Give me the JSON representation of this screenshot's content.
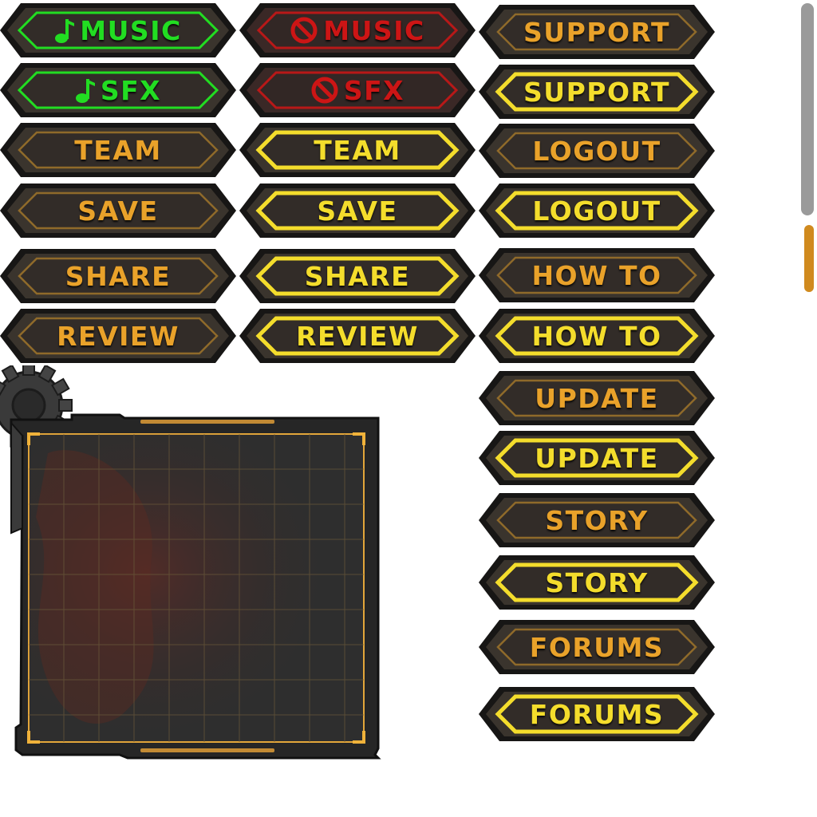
{
  "colors": {
    "gold": "#e9a22a",
    "yellow": "#f4dd2c",
    "green": "#22dd22",
    "red": "#cc1515",
    "dark_fill": "#2b2724",
    "scroll_track": "#9a9a9a",
    "scroll_thumb": "#d08a1e"
  },
  "buttons": [
    {
      "label": "MUSIC",
      "style": "on",
      "icon": "music-note-icon"
    },
    {
      "label": "SFX",
      "style": "on",
      "icon": "music-note-icon"
    },
    {
      "label": "TEAM",
      "style": "normal",
      "icon": ""
    },
    {
      "label": "SAVE",
      "style": "normal",
      "icon": ""
    },
    {
      "label": "SHARE",
      "style": "normal",
      "icon": ""
    },
    {
      "label": "REVIEW",
      "style": "normal",
      "icon": ""
    },
    {
      "label": "MUSIC",
      "style": "off",
      "icon": "prohibited-icon"
    },
    {
      "label": "SFX",
      "style": "off",
      "icon": "prohibited-icon"
    },
    {
      "label": "TEAM",
      "style": "highlight",
      "icon": ""
    },
    {
      "label": "SAVE",
      "style": "highlight",
      "icon": ""
    },
    {
      "label": "SHARE",
      "style": "highlight",
      "icon": ""
    },
    {
      "label": "REVIEW",
      "style": "highlight",
      "icon": ""
    },
    {
      "label": "SUPPORT",
      "style": "normal",
      "icon": ""
    },
    {
      "label": "SUPPORT",
      "style": "highlight",
      "icon": ""
    },
    {
      "label": "LOGOUT",
      "style": "normal",
      "icon": ""
    },
    {
      "label": "LOGOUT",
      "style": "highlight",
      "icon": ""
    },
    {
      "label": "HOW TO",
      "style": "normal",
      "icon": ""
    },
    {
      "label": "HOW TO",
      "style": "highlight",
      "icon": ""
    },
    {
      "label": "UPDATE",
      "style": "normal",
      "icon": ""
    },
    {
      "label": "UPDATE",
      "style": "highlight",
      "icon": ""
    },
    {
      "label": "STORY",
      "style": "normal",
      "icon": ""
    },
    {
      "label": "STORY",
      "style": "highlight",
      "icon": ""
    },
    {
      "label": "FORUMS",
      "style": "normal",
      "icon": ""
    },
    {
      "label": "FORUMS",
      "style": "highlight",
      "icon": ""
    }
  ],
  "panel": {
    "icon": "gear-icon"
  }
}
